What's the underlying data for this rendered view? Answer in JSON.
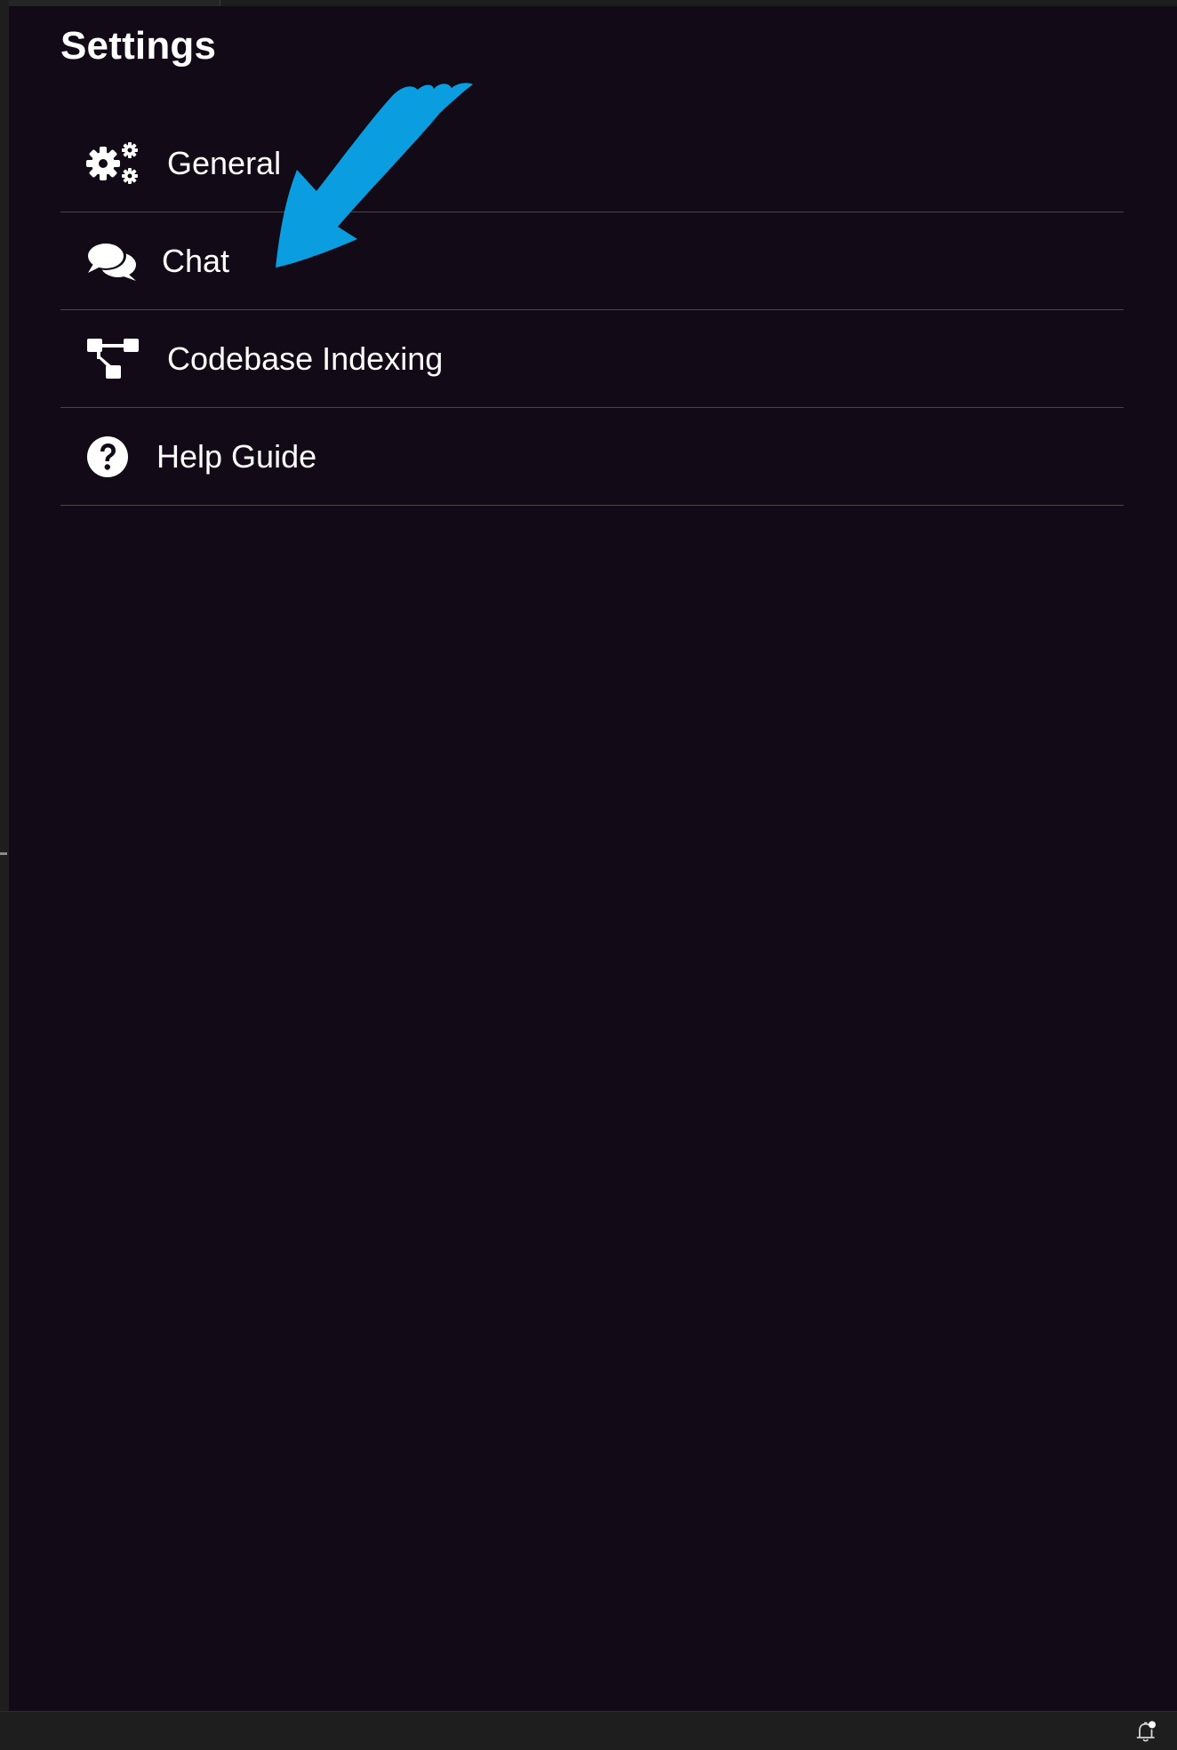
{
  "settings": {
    "title": "Settings",
    "items": [
      {
        "label": "General",
        "icon": "gears-icon"
      },
      {
        "label": "Chat",
        "icon": "chat-bubbles-icon"
      },
      {
        "label": "Codebase Indexing",
        "icon": "tree-structure-icon"
      },
      {
        "label": "Help Guide",
        "icon": "question-circle-icon"
      }
    ]
  },
  "colors": {
    "panel_background": "#130a17",
    "editor_background": "#1e1e1e",
    "divider": "#4a454d",
    "text": "#ffffff",
    "annotation_arrow": "#0a9de0"
  },
  "status_bar": {
    "notification_icon": "bell-with-dot-icon"
  }
}
